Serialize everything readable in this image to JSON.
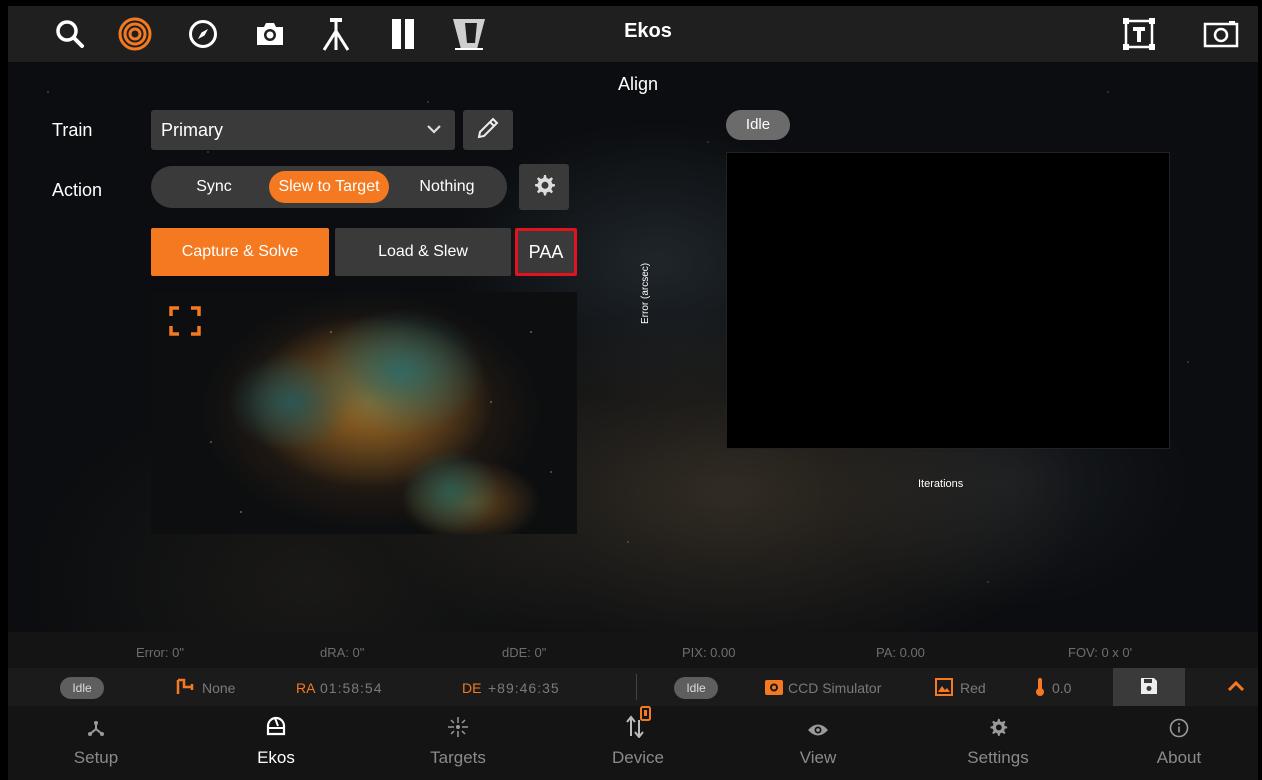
{
  "topbar": {
    "title": "Ekos",
    "icons": [
      "search-icon",
      "target-icon",
      "compass-icon",
      "camera-icon",
      "tripod-icon",
      "filter-icon",
      "dome-icon",
      "frame-text-icon",
      "screen-capture-icon"
    ],
    "active_icon": "target-icon",
    "active_color": "#f47920"
  },
  "align": {
    "title": "Align",
    "train_label": "Train",
    "train_value": "Primary",
    "action_label": "Action",
    "actions": [
      "Sync",
      "Slew to Target",
      "Nothing"
    ],
    "active_action": "Slew to Target",
    "buttons": {
      "capture_solve": "Capture & Solve",
      "load_slew": "Load & Slew",
      "paa": "PAA"
    },
    "status": "Idle",
    "plot": {
      "ylabel": "Error (arcsec)",
      "xlabel": "Iterations"
    }
  },
  "stats": {
    "error": "Error: 0\"",
    "dra": "dRA: 0\"",
    "dde": "dDE: 0\"",
    "pix": "PIX: 0.00",
    "pa": "PA: 0.00",
    "fov": "FOV: 0 x 0'"
  },
  "infobar": {
    "mount_status": "Idle",
    "pier": "None",
    "ra_label": "RA",
    "ra_value": "01:58:54",
    "de_label": "DE",
    "de_value": "+89:46:35",
    "camera_status": "Idle",
    "camera": "CCD Simulator",
    "filter": "Red",
    "temperature": "0.0"
  },
  "nav": {
    "items": [
      {
        "label": "Setup",
        "icon": "setup-icon"
      },
      {
        "label": "Ekos",
        "icon": "ekos-icon"
      },
      {
        "label": "Targets",
        "icon": "targets-icon"
      },
      {
        "label": "Device",
        "icon": "device-icon"
      },
      {
        "label": "View",
        "icon": "view-icon"
      },
      {
        "label": "Settings",
        "icon": "settings-icon"
      },
      {
        "label": "About",
        "icon": "about-icon"
      }
    ],
    "active": "Ekos"
  }
}
